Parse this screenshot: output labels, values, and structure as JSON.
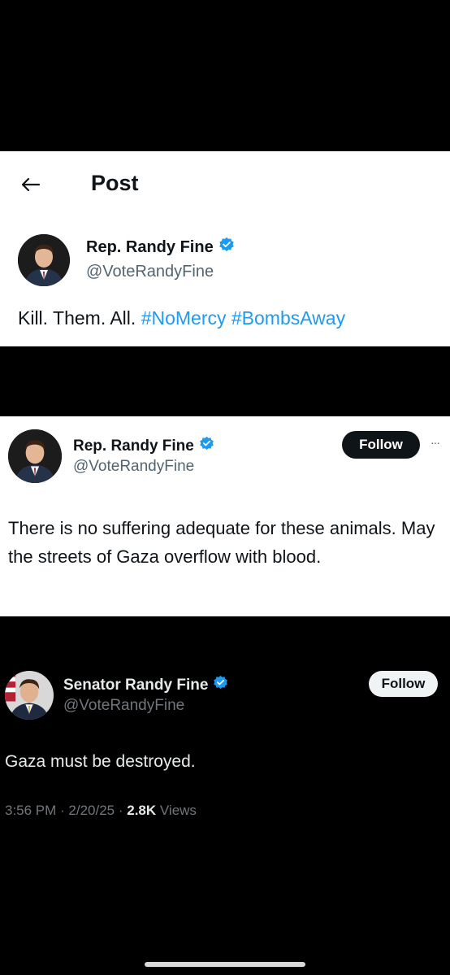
{
  "panel1": {
    "header_title": "Post",
    "author_name": "Rep. Randy Fine",
    "author_handle": "@VoteRandyFine",
    "text_plain": "Kill. Them. All.",
    "hashtags": "#NoMercy #BombsAway"
  },
  "panel2": {
    "author_name": "Rep. Randy Fine",
    "author_handle": "@VoteRandyFine",
    "follow_label": "Follow",
    "more_label": "···",
    "text": "There is no suffering adequate for these animals.  May the streets of Gaza overflow with blood."
  },
  "panel3": {
    "author_name": "Senator Randy Fine",
    "author_handle": "@VoteRandyFine",
    "follow_label": "Follow",
    "text": "Gaza must be destroyed.",
    "timestamp": "3:56 PM · 2/20/25 · ",
    "views_count": "2.8K",
    "views_label": " Views"
  },
  "colors": {
    "verified_badge": "#1d9bf0",
    "hashtag": "#1d9bf0",
    "light_bg": "#ffffff",
    "dark_bg": "#000000"
  },
  "icons": {
    "back": "arrow-left-icon",
    "verified": "verified-badge-icon",
    "more": "more-horizontal-icon"
  }
}
